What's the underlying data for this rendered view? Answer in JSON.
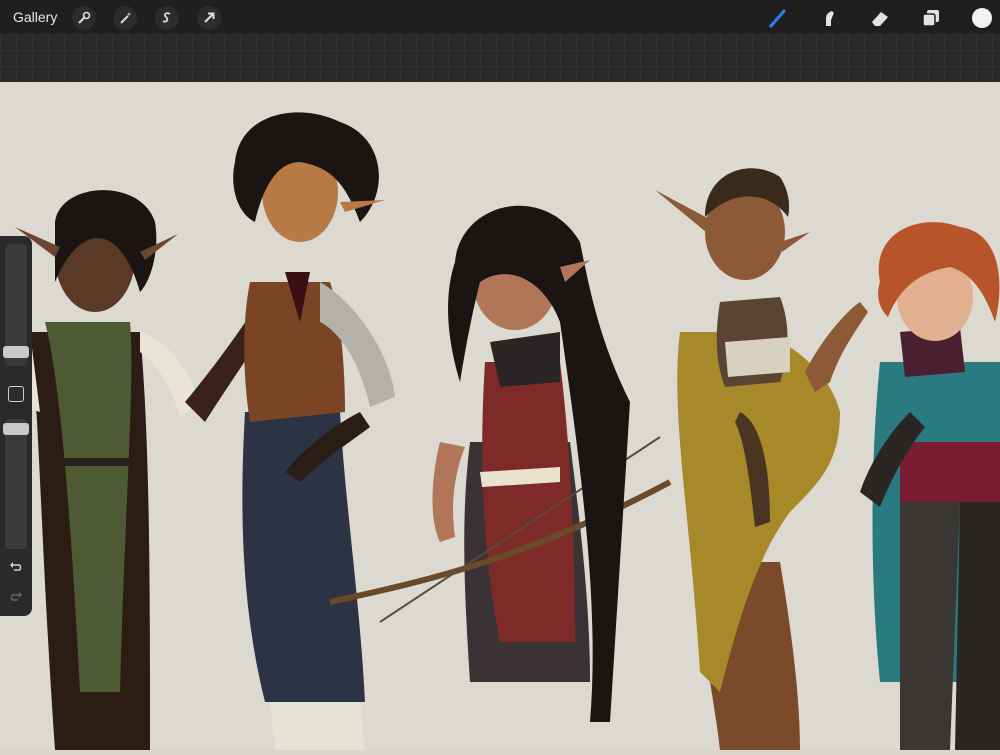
{
  "toolbar": {
    "gallery_label": "Gallery",
    "left_tools": [
      "actions-wrench-icon",
      "adjustments-wand-icon",
      "selection-s-icon",
      "transform-arrow-icon"
    ],
    "right_tools": [
      "brush-icon",
      "smudge-icon",
      "eraser-icon",
      "layers-icon",
      "color-swatch"
    ],
    "accent_color": "#2e7cf6",
    "current_color": "#f2f2f2"
  },
  "canvas": {
    "background": "#dcd9d1",
    "artwork": "illustration-of-five-fantasy-characters"
  },
  "sidebar": {
    "brush_size_level": 0.31,
    "opacity_level": 0.58,
    "buttons": [
      "modify-square-icon",
      "undo-icon",
      "redo-icon"
    ]
  }
}
